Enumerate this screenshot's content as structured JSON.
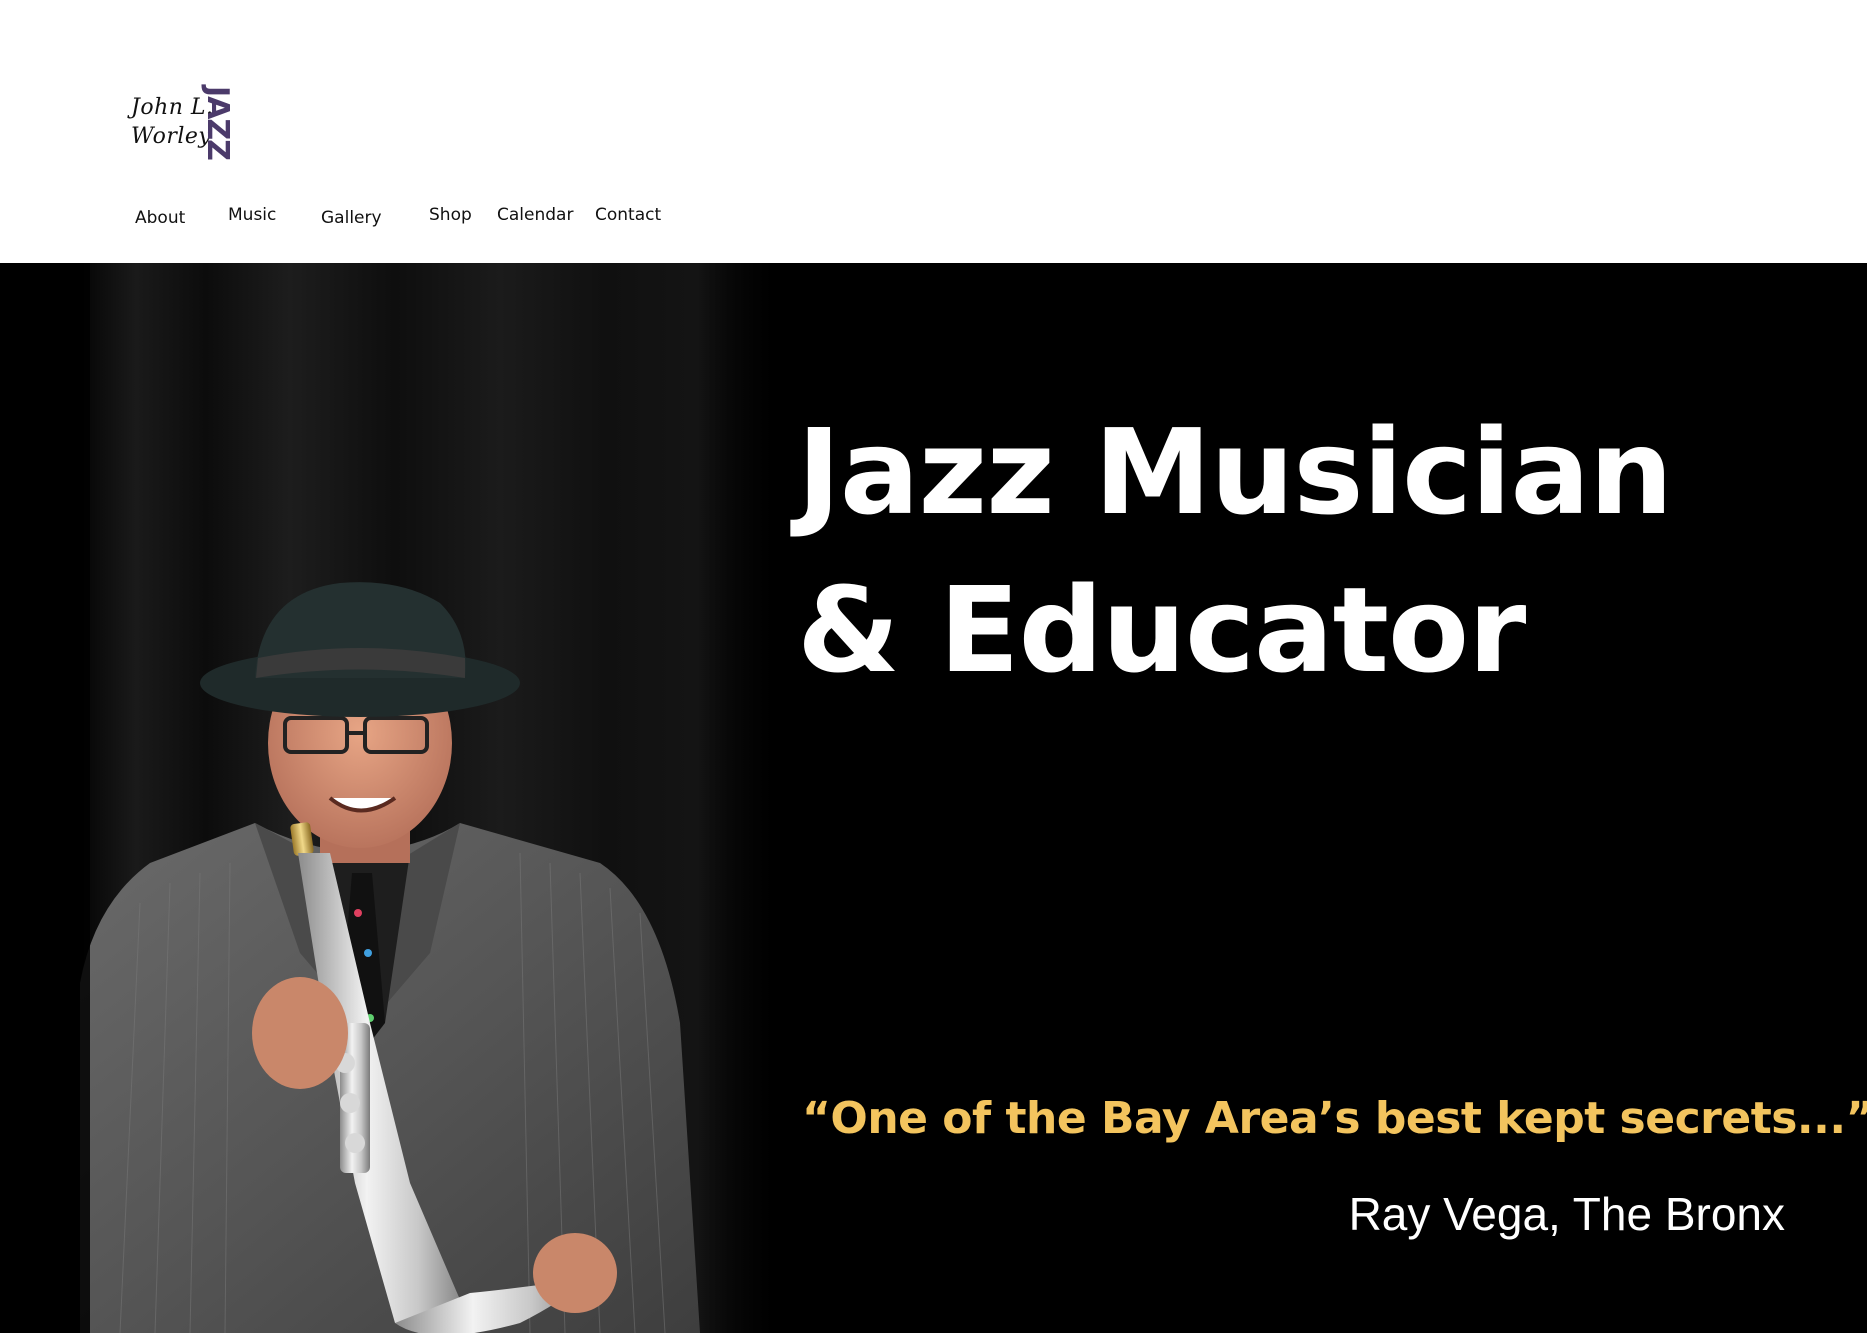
{
  "header": {
    "logo": {
      "line1": "John L.",
      "line2": "Worley",
      "mark": "JAZZ",
      "mark_color": "#4b3a6a"
    },
    "nav": [
      {
        "label": "About"
      },
      {
        "label": "Music"
      },
      {
        "label": "Gallery"
      },
      {
        "label": "Shop"
      },
      {
        "label": "Calendar"
      },
      {
        "label": "Contact"
      }
    ]
  },
  "hero": {
    "headline_line1": "Jazz Musician",
    "headline_line2": "& Educator",
    "quote": "“One of the Bay Area’s best kept secrets...”",
    "attribution": "Ray Vega, The Bronx",
    "colors": {
      "background": "#000000",
      "headline": "#ffffff",
      "quote": "#f3c45e"
    }
  }
}
